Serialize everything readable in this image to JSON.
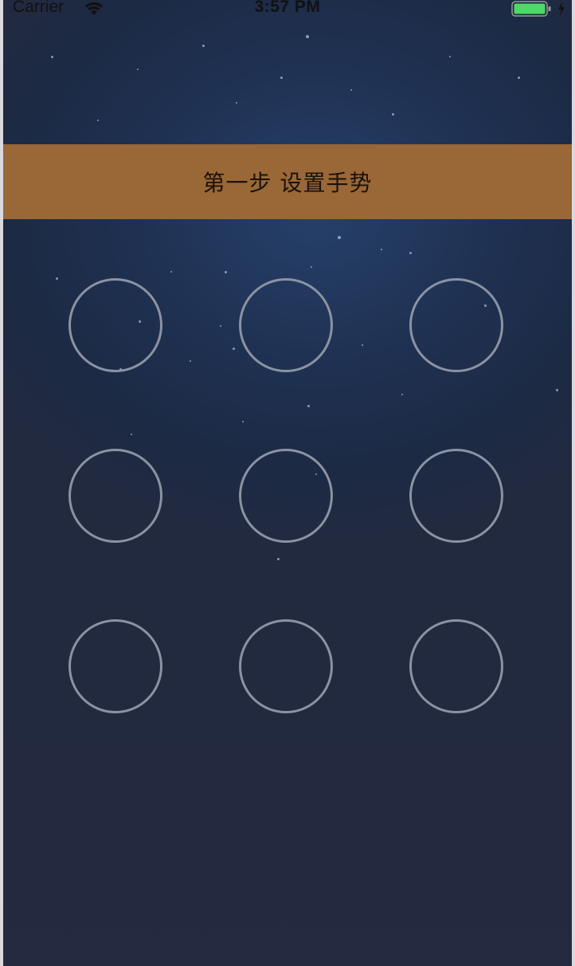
{
  "status_bar": {
    "carrier": "Carrier",
    "time": "3:57 PM",
    "wifi_icon": "wifi-icon",
    "battery_icon": "battery-icon",
    "battery_color": "#4cd964",
    "charging_icon": "lightning-bolt-icon"
  },
  "banner": {
    "title": "第一步 设置手势",
    "background_color": "#9a6736"
  },
  "gesture_grid": {
    "rows": 3,
    "columns": 3,
    "nodes": [
      {
        "id": 1,
        "selected": false
      },
      {
        "id": 2,
        "selected": false
      },
      {
        "id": 3,
        "selected": false
      },
      {
        "id": 4,
        "selected": false
      },
      {
        "id": 5,
        "selected": false
      },
      {
        "id": 6,
        "selected": false
      },
      {
        "id": 7,
        "selected": false
      },
      {
        "id": 8,
        "selected": false
      },
      {
        "id": 9,
        "selected": false
      }
    ],
    "node_outline_color": "#8b93a3"
  },
  "background": {
    "description_colors": [
      "#26406a",
      "#1f3152",
      "#222a40"
    ]
  }
}
